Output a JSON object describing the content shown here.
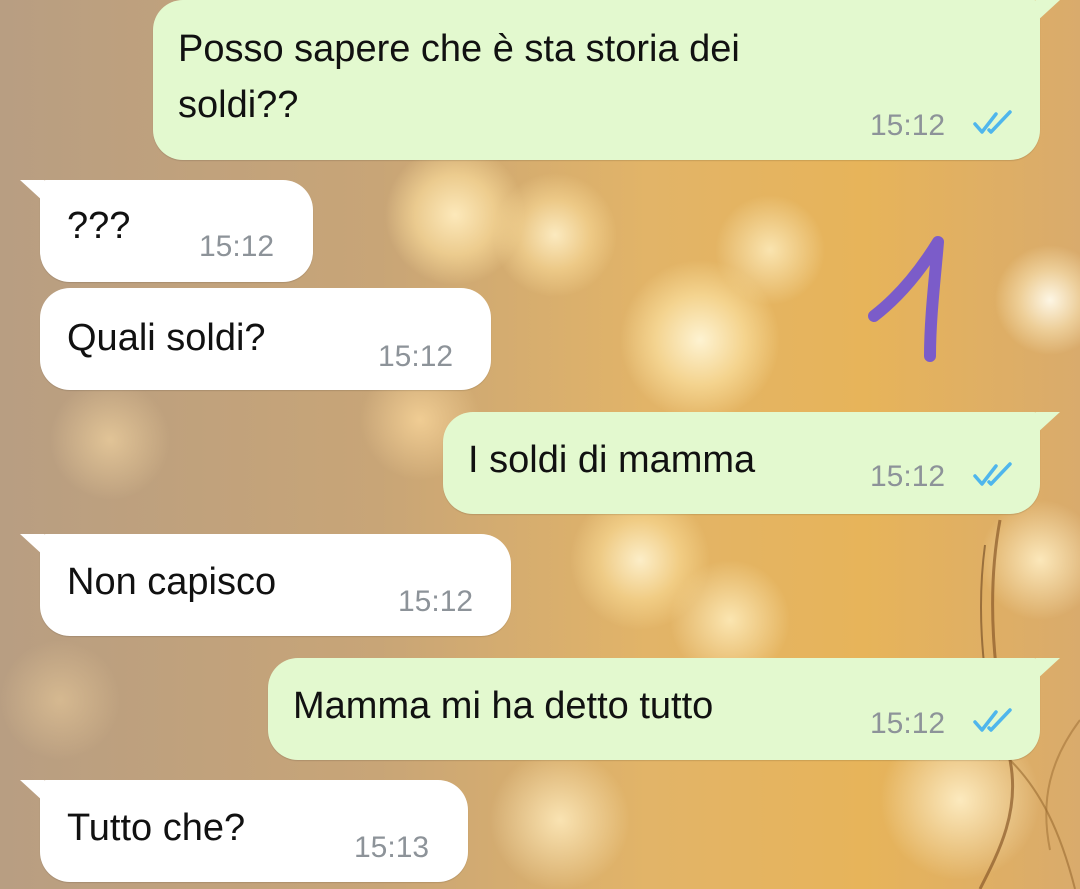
{
  "conversation": {
    "messages": [
      {
        "direction": "outgoing",
        "text": "Posso sapere che è sta storia dei\nsoldi??",
        "time": "15:12",
        "status_icon": "double-check-read-icon",
        "status_color": "#4fb6ec"
      },
      {
        "direction": "incoming",
        "text": "???",
        "time": "15:12"
      },
      {
        "direction": "incoming",
        "text": "Quali soldi?",
        "time": "15:12"
      },
      {
        "direction": "outgoing",
        "text": "I soldi di mamma",
        "time": "15:12",
        "status_icon": "double-check-read-icon",
        "status_color": "#4fb6ec"
      },
      {
        "direction": "incoming",
        "text": "Non capisco",
        "time": "15:12"
      },
      {
        "direction": "outgoing",
        "text": "Mamma mi ha detto tutto",
        "time": "15:12",
        "status_icon": "double-check-read-icon",
        "status_color": "#4fb6ec"
      },
      {
        "direction": "incoming",
        "text": "Tutto che?",
        "time": "15:13"
      }
    ]
  },
  "annotation": {
    "text": "1",
    "color": "#7b5cc9"
  },
  "colors": {
    "outgoing_bubble": "#e3f9cf",
    "incoming_bubble": "#ffffff",
    "timestamp": "#8d9399"
  }
}
